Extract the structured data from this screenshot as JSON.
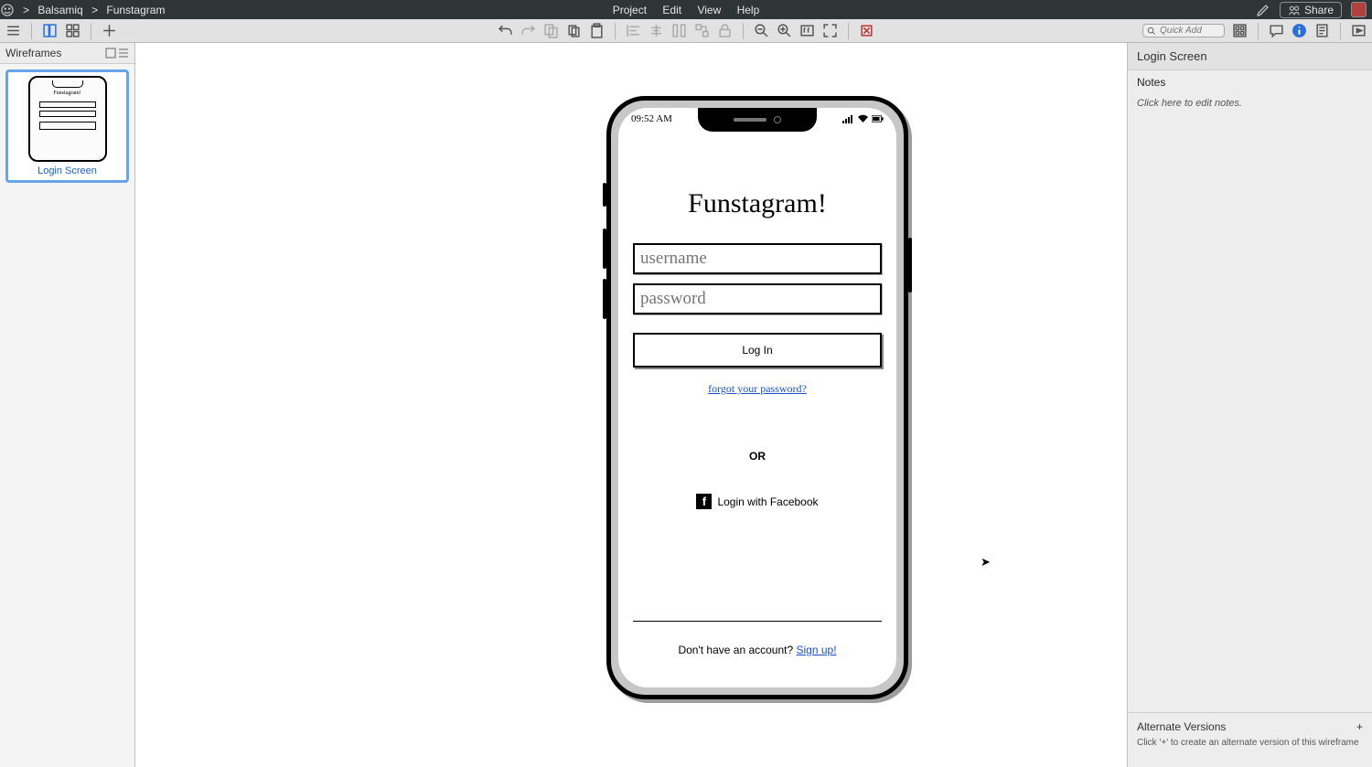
{
  "breadcrumb": {
    "root": "Balsamiq",
    "sep": ">",
    "project": "Funstagram"
  },
  "menus": {
    "project": "Project",
    "edit": "Edit",
    "view": "View",
    "help": "Help"
  },
  "share": "Share",
  "quickadd": "Quick Add",
  "leftpanel": {
    "title": "Wireframes",
    "thumb_label": "Login Screen",
    "mini_title": "Funstagram!"
  },
  "phone": {
    "time": "09:52 AM",
    "title": "Funstagram!",
    "username_ph": "username",
    "password_ph": "password",
    "login_btn": "Log In",
    "forgot": "forgot your password?",
    "or": "OR",
    "fb": "Login with Facebook",
    "no_account": "Don't have an account? ",
    "signup": "Sign up!"
  },
  "rightpanel": {
    "title": "Login Screen",
    "notes_h": "Notes",
    "notes_body": "Click here to edit notes.",
    "alt_h": "Alternate Versions",
    "alt_plus": "+",
    "alt_hint": "Click '+' to create an alternate version of this wireframe"
  }
}
